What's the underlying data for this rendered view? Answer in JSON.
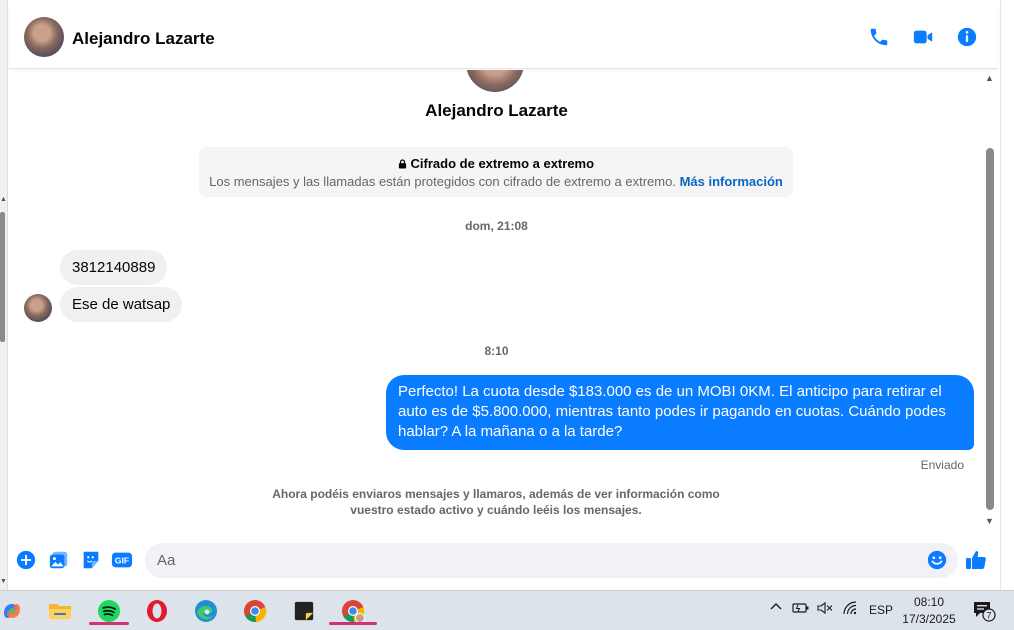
{
  "header": {
    "contact_name": "Alejandro Lazarte",
    "icons": [
      "phone-icon",
      "video-call-icon",
      "info-icon"
    ]
  },
  "chat": {
    "profile_name": "Alejandro Lazarte",
    "encryption": {
      "title": "Cifrado de extremo a extremo",
      "text": "Los mensajes y las llamadas están protegidos con cifrado de extremo a extremo.",
      "link": "Más información"
    },
    "timestamp_1": "dom, 21:08",
    "incoming": [
      {
        "text": "3812140889"
      },
      {
        "text": "Ese de watsap"
      }
    ],
    "timestamp_2": "8:10",
    "outgoing": {
      "text": "Perfecto! La cuota desde $183.000 es de un MOBI 0KM. El anticipo para retirar el auto es de $5.800.000, mientras tanto podes ir pagando en cuotas. Cuándo podes hablar? A la mañana o a la tarde?",
      "status": "Enviado"
    },
    "notice": "Ahora podéis enviaros mensajes y llamaros, además de ver información como vuestro estado activo y cuándo leéis los mensajes."
  },
  "composer": {
    "placeholder": "Aa",
    "gif_label": "GIF",
    "icons": [
      "plus-icon",
      "photo-icon",
      "sticker-icon",
      "gif-icon",
      "emoji-icon",
      "like-icon"
    ]
  },
  "taskbar": {
    "apps": [
      "copilot-icon",
      "file-explorer-icon",
      "spotify-icon",
      "opera-icon",
      "edge-icon",
      "chrome-icon",
      "sticky-notes-icon",
      "chrome-profile-icon"
    ],
    "language": "ESP",
    "time": "08:10",
    "date": "17/3/2025",
    "notification_count": "7"
  },
  "colors": {
    "accent": "#0a7cff",
    "link": "#0a66c2",
    "incoming_bubble": "#f0f0f0",
    "taskbar": "#dde3ea"
  }
}
